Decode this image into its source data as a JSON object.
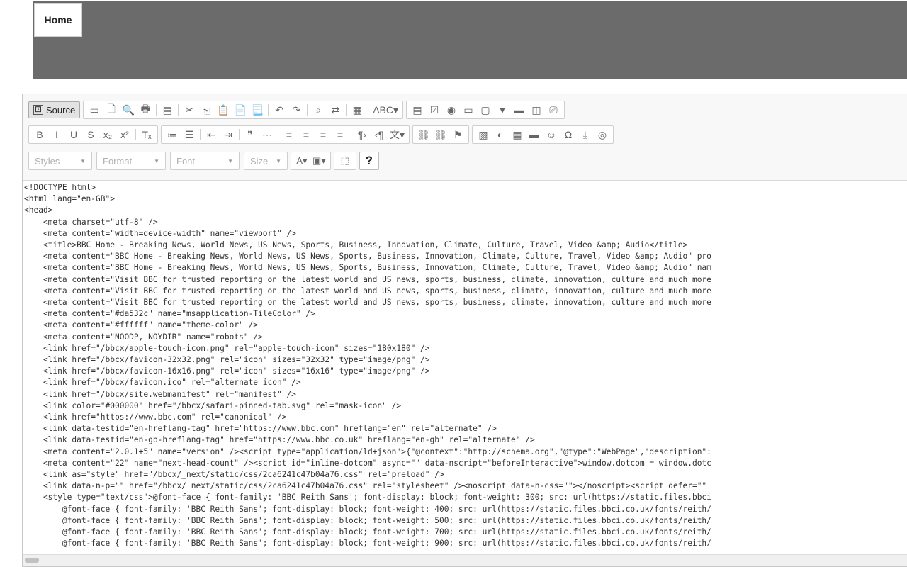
{
  "header": {
    "home_tab": "Home"
  },
  "toolbar": {
    "source_label": "Source",
    "row1": [
      {
        "name": "save-icon",
        "glyph": "▭"
      },
      {
        "name": "new-page-icon",
        "glyph": "🗋"
      },
      {
        "name": "preview-icon",
        "glyph": "🔍"
      },
      {
        "name": "print-icon",
        "glyph": "🖶"
      },
      {
        "sep": true
      },
      {
        "name": "templates-icon",
        "glyph": "▤"
      },
      {
        "sep": true
      },
      {
        "name": "cut-icon",
        "glyph": "✂"
      },
      {
        "name": "copy-icon",
        "glyph": "⎘"
      },
      {
        "name": "paste-icon",
        "glyph": "📋"
      },
      {
        "name": "paste-text-icon",
        "glyph": "📄"
      },
      {
        "name": "paste-word-icon",
        "glyph": "📃"
      },
      {
        "sep": true
      },
      {
        "name": "undo-icon",
        "glyph": "↶"
      },
      {
        "name": "redo-icon",
        "glyph": "↷"
      },
      {
        "sep": true
      },
      {
        "name": "find-icon",
        "glyph": "⌕"
      },
      {
        "name": "replace-icon",
        "glyph": "⇄"
      },
      {
        "sep": true
      },
      {
        "name": "select-all-icon",
        "glyph": "▦"
      },
      {
        "sep": true
      },
      {
        "name": "spellcheck-icon",
        "glyph": "ABC▾"
      }
    ],
    "row1b": [
      {
        "name": "form-icon",
        "glyph": "▤"
      },
      {
        "name": "checkbox-icon",
        "glyph": "☑"
      },
      {
        "name": "radio-icon",
        "glyph": "◉"
      },
      {
        "name": "textfield-icon",
        "glyph": "▭"
      },
      {
        "name": "textarea-icon",
        "glyph": "▢"
      },
      {
        "name": "select-field-icon",
        "glyph": "▾"
      },
      {
        "name": "button-field-icon",
        "glyph": "▬"
      },
      {
        "name": "image-button-icon",
        "glyph": "◫"
      },
      {
        "name": "hidden-field-icon",
        "glyph": "⎚"
      }
    ],
    "row2a": [
      {
        "name": "bold-icon",
        "glyph": "B"
      },
      {
        "name": "italic-icon",
        "glyph": "I"
      },
      {
        "name": "underline-icon",
        "glyph": "U"
      },
      {
        "name": "strikethrough-icon",
        "glyph": "S"
      },
      {
        "name": "subscript-icon",
        "glyph": "x₂"
      },
      {
        "name": "superscript-icon",
        "glyph": "x²"
      },
      {
        "sep": true
      },
      {
        "name": "remove-format-icon",
        "glyph": "Tₓ"
      }
    ],
    "row2b": [
      {
        "name": "numbered-list-icon",
        "glyph": "≔"
      },
      {
        "name": "bulleted-list-icon",
        "glyph": "☰"
      },
      {
        "sep": true
      },
      {
        "name": "decrease-indent-icon",
        "glyph": "⇤"
      },
      {
        "name": "increase-indent-icon",
        "glyph": "⇥"
      },
      {
        "sep": true
      },
      {
        "name": "blockquote-icon",
        "glyph": "❞"
      },
      {
        "name": "div-icon",
        "glyph": "⋯"
      },
      {
        "sep": true
      },
      {
        "name": "align-left-icon",
        "glyph": "≡"
      },
      {
        "name": "align-center-icon",
        "glyph": "≡"
      },
      {
        "name": "align-right-icon",
        "glyph": "≡"
      },
      {
        "name": "justify-icon",
        "glyph": "≡"
      },
      {
        "sep": true
      },
      {
        "name": "ltr-icon",
        "glyph": "¶›"
      },
      {
        "name": "rtl-icon",
        "glyph": "‹¶"
      },
      {
        "name": "language-icon",
        "glyph": "文▾"
      }
    ],
    "row2c": [
      {
        "name": "link-icon",
        "glyph": "⛓"
      },
      {
        "name": "unlink-icon",
        "glyph": "⛓"
      },
      {
        "name": "anchor-icon",
        "glyph": "⚑"
      }
    ],
    "row2d": [
      {
        "name": "image-icon",
        "glyph": "▨"
      },
      {
        "name": "flash-icon",
        "glyph": "◐"
      },
      {
        "name": "table-icon",
        "glyph": "▦"
      },
      {
        "name": "horizontal-line-icon",
        "glyph": "▬"
      },
      {
        "name": "smiley-icon",
        "glyph": "☺"
      },
      {
        "name": "special-char-icon",
        "glyph": "Ω"
      },
      {
        "name": "page-break-icon",
        "glyph": "⤓"
      },
      {
        "name": "iframe-icon",
        "glyph": "◎"
      }
    ],
    "combos": [
      {
        "name": "styles-combo",
        "label": "Styles",
        "w": 90
      },
      {
        "name": "format-combo",
        "label": "Format",
        "w": 98
      },
      {
        "name": "font-combo",
        "label": "Font",
        "w": 98
      },
      {
        "name": "size-combo",
        "label": "Size",
        "w": 62
      }
    ],
    "text_color_glyph": "A▾",
    "bg_color_glyph": "▣▾",
    "maximize_glyph": "⬚",
    "help_label": "?"
  },
  "source_code": "<!DOCTYPE html>\n<html lang=\"en-GB\">\n<head>\n    <meta charset=\"utf-8\" />\n    <meta content=\"width=device-width\" name=\"viewport\" />\n    <title>BBC Home - Breaking News, World News, US News, Sports, Business, Innovation, Climate, Culture, Travel, Video &amp; Audio</title>\n    <meta content=\"BBC Home - Breaking News, World News, US News, Sports, Business, Innovation, Climate, Culture, Travel, Video &amp; Audio\" pro\n    <meta content=\"BBC Home - Breaking News, World News, US News, Sports, Business, Innovation, Climate, Culture, Travel, Video &amp; Audio\" nam\n    <meta content=\"Visit BBC for trusted reporting on the latest world and US news, sports, business, climate, innovation, culture and much more\n    <meta content=\"Visit BBC for trusted reporting on the latest world and US news, sports, business, climate, innovation, culture and much more\n    <meta content=\"Visit BBC for trusted reporting on the latest world and US news, sports, business, climate, innovation, culture and much more\n    <meta content=\"#da532c\" name=\"msapplication-TileColor\" />\n    <meta content=\"#ffffff\" name=\"theme-color\" />\n    <meta content=\"NOODP, NOYDIR\" name=\"robots\" />\n    <link href=\"/bbcx/apple-touch-icon.png\" rel=\"apple-touch-icon\" sizes=\"180x180\" />\n    <link href=\"/bbcx/favicon-32x32.png\" rel=\"icon\" sizes=\"32x32\" type=\"image/png\" />\n    <link href=\"/bbcx/favicon-16x16.png\" rel=\"icon\" sizes=\"16x16\" type=\"image/png\" />\n    <link href=\"/bbcx/favicon.ico\" rel=\"alternate icon\" />\n    <link href=\"/bbcx/site.webmanifest\" rel=\"manifest\" />\n    <link color=\"#000000\" href=\"/bbcx/safari-pinned-tab.svg\" rel=\"mask-icon\" />\n    <link href=\"https://www.bbc.com\" rel=\"canonical\" />\n    <link data-testid=\"en-hreflang-tag\" href=\"https://www.bbc.com\" hreflang=\"en\" rel=\"alternate\" />\n    <link data-testid=\"en-gb-hreflang-tag\" href=\"https://www.bbc.co.uk\" hreflang=\"en-gb\" rel=\"alternate\" />\n    <meta content=\"2.0.1+5\" name=\"version\" /><script type=\"application/ld+json\">{\"@context\":\"http://schema.org\",\"@type\":\"WebPage\",\"description\":\n    <meta content=\"22\" name=\"next-head-count\" /><script id=\"inline-dotcom\" async=\"\" data-nscript=\"beforeInteractive\">window.dotcom = window.dotc\n    <link as=\"style\" href=\"/bbcx/_next/static/css/2ca6241c47b04a76.css\" rel=\"preload\" />\n    <link data-n-p=\"\" href=\"/bbcx/_next/static/css/2ca6241c47b04a76.css\" rel=\"stylesheet\" /><noscript data-n-css=\"\"></noscript><script defer=\"\" \n    <style type=\"text/css\">@font-face { font-family: 'BBC Reith Sans'; font-display: block; font-weight: 300; src: url(https://static.files.bbci\n        @font-face { font-family: 'BBC Reith Sans'; font-display: block; font-weight: 400; src: url(https://static.files.bbci.co.uk/fonts/reith/\n        @font-face { font-family: 'BBC Reith Sans'; font-display: block; font-weight: 500; src: url(https://static.files.bbci.co.uk/fonts/reith/\n        @font-face { font-family: 'BBC Reith Sans'; font-display: block; font-weight: 700; src: url(https://static.files.bbci.co.uk/fonts/reith/\n        @font-face { font-family: 'BBC Reith Sans'; font-display: block; font-weight: 900; src: url(https://static.files.bbci.co.uk/fonts/reith/"
}
